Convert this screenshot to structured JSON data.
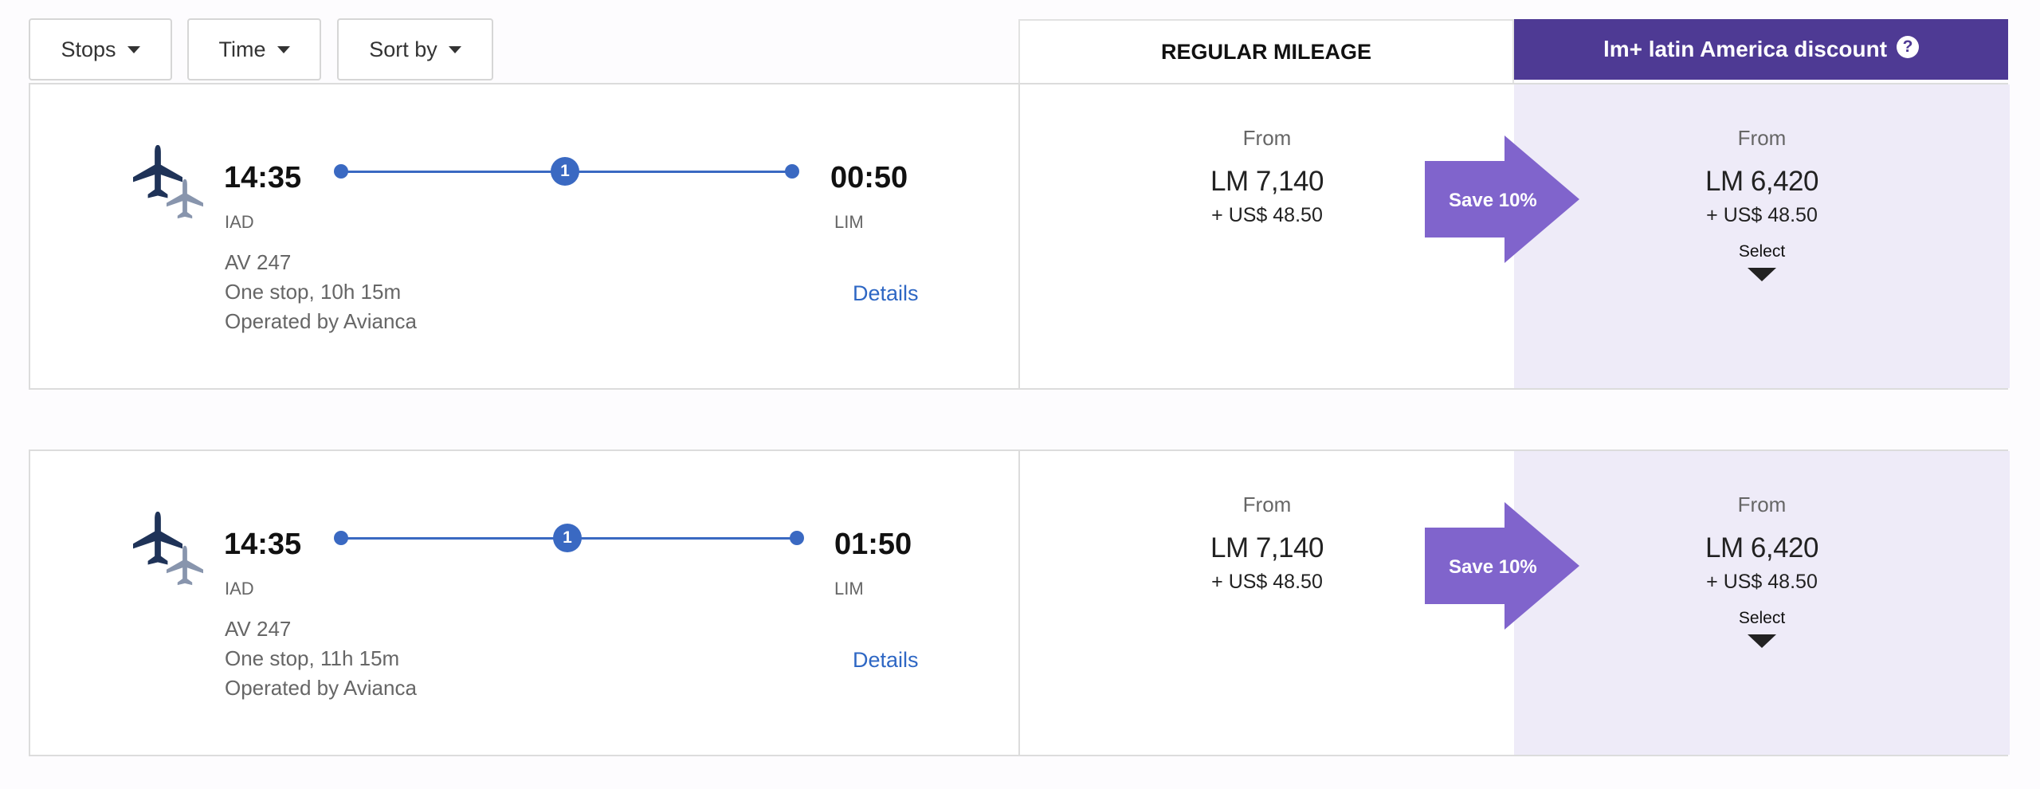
{
  "filters": [
    {
      "label": "Stops"
    },
    {
      "label": "Time"
    },
    {
      "label": "Sort by"
    }
  ],
  "columns": {
    "regular": "REGULAR MILEAGE",
    "discount": "lm+ latin America discount",
    "help_symbol": "?"
  },
  "flights": [
    {
      "depart_time": "14:35",
      "depart_code": "IAD",
      "arrive_time": "00:50",
      "arrive_code": "LIM",
      "stops_count": "1",
      "flight_number": "AV 247",
      "duration": "One stop, 10h 15m",
      "operator": "Operated by Avianca",
      "details_label": "Details",
      "regular": {
        "from": "From",
        "miles": "LM 7,140",
        "tax": "+ US$ 48.50"
      },
      "save_label": "Save 10%",
      "discount": {
        "from": "From",
        "miles": "LM 6,420",
        "tax": "+ US$ 48.50",
        "select": "Select"
      }
    },
    {
      "depart_time": "14:35",
      "depart_code": "IAD",
      "arrive_time": "01:50",
      "arrive_code": "LIM",
      "stops_count": "1",
      "flight_number": "AV 247",
      "duration": "One stop, 11h 15m",
      "operator": "Operated by Avianca",
      "details_label": "Details",
      "regular": {
        "from": "From",
        "miles": "LM 7,140",
        "tax": "+ US$ 48.50"
      },
      "save_label": "Save 10%",
      "discount": {
        "from": "From",
        "miles": "LM 6,420",
        "tax": "+ US$ 48.50",
        "select": "Select"
      }
    }
  ],
  "colors": {
    "accent": "#4e3a94",
    "save_arrow": "#8064cc",
    "route": "#3a69c2",
    "link": "#2e67c4",
    "discount_bg": "#eeebf8"
  },
  "icons": {
    "plane": "airplane-icon",
    "help": "help-icon",
    "caret": "caret-down-icon"
  }
}
